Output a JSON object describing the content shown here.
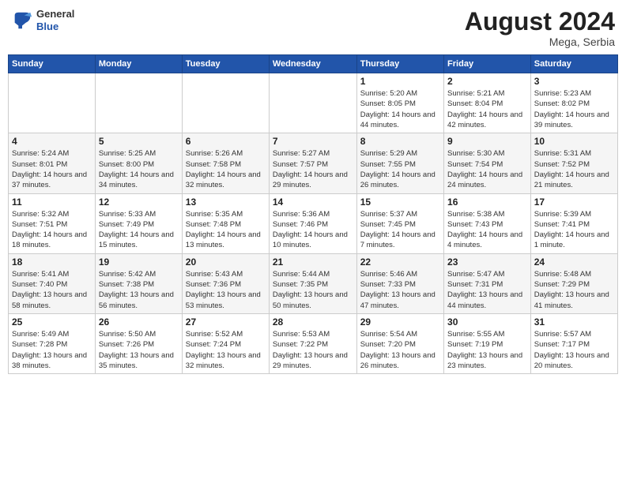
{
  "header": {
    "logo": {
      "general": "General",
      "blue": "Blue"
    },
    "title": "August 2024",
    "location": "Mega, Serbia"
  },
  "weekdays": [
    "Sunday",
    "Monday",
    "Tuesday",
    "Wednesday",
    "Thursday",
    "Friday",
    "Saturday"
  ],
  "weeks": [
    [
      null,
      null,
      null,
      null,
      {
        "day": 1,
        "sunrise": "5:20 AM",
        "sunset": "8:05 PM",
        "daylight": "14 hours and 44 minutes."
      },
      {
        "day": 2,
        "sunrise": "5:21 AM",
        "sunset": "8:04 PM",
        "daylight": "14 hours and 42 minutes."
      },
      {
        "day": 3,
        "sunrise": "5:23 AM",
        "sunset": "8:02 PM",
        "daylight": "14 hours and 39 minutes."
      }
    ],
    [
      {
        "day": 4,
        "sunrise": "5:24 AM",
        "sunset": "8:01 PM",
        "daylight": "14 hours and 37 minutes."
      },
      {
        "day": 5,
        "sunrise": "5:25 AM",
        "sunset": "8:00 PM",
        "daylight": "14 hours and 34 minutes."
      },
      {
        "day": 6,
        "sunrise": "5:26 AM",
        "sunset": "7:58 PM",
        "daylight": "14 hours and 32 minutes."
      },
      {
        "day": 7,
        "sunrise": "5:27 AM",
        "sunset": "7:57 PM",
        "daylight": "14 hours and 29 minutes."
      },
      {
        "day": 8,
        "sunrise": "5:29 AM",
        "sunset": "7:55 PM",
        "daylight": "14 hours and 26 minutes."
      },
      {
        "day": 9,
        "sunrise": "5:30 AM",
        "sunset": "7:54 PM",
        "daylight": "14 hours and 24 minutes."
      },
      {
        "day": 10,
        "sunrise": "5:31 AM",
        "sunset": "7:52 PM",
        "daylight": "14 hours and 21 minutes."
      }
    ],
    [
      {
        "day": 11,
        "sunrise": "5:32 AM",
        "sunset": "7:51 PM",
        "daylight": "14 hours and 18 minutes."
      },
      {
        "day": 12,
        "sunrise": "5:33 AM",
        "sunset": "7:49 PM",
        "daylight": "14 hours and 15 minutes."
      },
      {
        "day": 13,
        "sunrise": "5:35 AM",
        "sunset": "7:48 PM",
        "daylight": "14 hours and 13 minutes."
      },
      {
        "day": 14,
        "sunrise": "5:36 AM",
        "sunset": "7:46 PM",
        "daylight": "14 hours and 10 minutes."
      },
      {
        "day": 15,
        "sunrise": "5:37 AM",
        "sunset": "7:45 PM",
        "daylight": "14 hours and 7 minutes."
      },
      {
        "day": 16,
        "sunrise": "5:38 AM",
        "sunset": "7:43 PM",
        "daylight": "14 hours and 4 minutes."
      },
      {
        "day": 17,
        "sunrise": "5:39 AM",
        "sunset": "7:41 PM",
        "daylight": "14 hours and 1 minute."
      }
    ],
    [
      {
        "day": 18,
        "sunrise": "5:41 AM",
        "sunset": "7:40 PM",
        "daylight": "13 hours and 58 minutes."
      },
      {
        "day": 19,
        "sunrise": "5:42 AM",
        "sunset": "7:38 PM",
        "daylight": "13 hours and 56 minutes."
      },
      {
        "day": 20,
        "sunrise": "5:43 AM",
        "sunset": "7:36 PM",
        "daylight": "13 hours and 53 minutes."
      },
      {
        "day": 21,
        "sunrise": "5:44 AM",
        "sunset": "7:35 PM",
        "daylight": "13 hours and 50 minutes."
      },
      {
        "day": 22,
        "sunrise": "5:46 AM",
        "sunset": "7:33 PM",
        "daylight": "13 hours and 47 minutes."
      },
      {
        "day": 23,
        "sunrise": "5:47 AM",
        "sunset": "7:31 PM",
        "daylight": "13 hours and 44 minutes."
      },
      {
        "day": 24,
        "sunrise": "5:48 AM",
        "sunset": "7:29 PM",
        "daylight": "13 hours and 41 minutes."
      }
    ],
    [
      {
        "day": 25,
        "sunrise": "5:49 AM",
        "sunset": "7:28 PM",
        "daylight": "13 hours and 38 minutes."
      },
      {
        "day": 26,
        "sunrise": "5:50 AM",
        "sunset": "7:26 PM",
        "daylight": "13 hours and 35 minutes."
      },
      {
        "day": 27,
        "sunrise": "5:52 AM",
        "sunset": "7:24 PM",
        "daylight": "13 hours and 32 minutes."
      },
      {
        "day": 28,
        "sunrise": "5:53 AM",
        "sunset": "7:22 PM",
        "daylight": "13 hours and 29 minutes."
      },
      {
        "day": 29,
        "sunrise": "5:54 AM",
        "sunset": "7:20 PM",
        "daylight": "13 hours and 26 minutes."
      },
      {
        "day": 30,
        "sunrise": "5:55 AM",
        "sunset": "7:19 PM",
        "daylight": "13 hours and 23 minutes."
      },
      {
        "day": 31,
        "sunrise": "5:57 AM",
        "sunset": "7:17 PM",
        "daylight": "13 hours and 20 minutes."
      }
    ]
  ]
}
